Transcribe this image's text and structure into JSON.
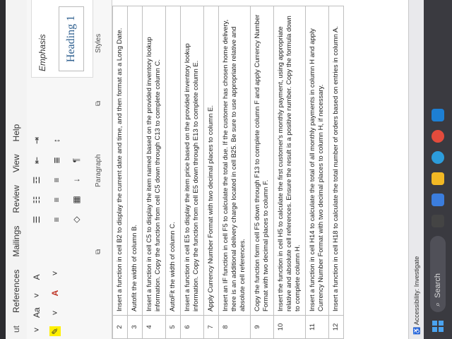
{
  "ribbon": {
    "tabs": [
      "ut",
      "References",
      "Mailings",
      "Review",
      "View",
      "Help"
    ],
    "font_size_label": "Aa",
    "paragraph_label": "Paragraph",
    "styles_label": "Styles",
    "style_emphasis": "Emphasis",
    "style_heading1": "Heading 1",
    "style_heading_partial": "Hea"
  },
  "steps": [
    {
      "num": "2",
      "text": "Insert a function in cell B2 to display the current date and time, and then format as a Long Date."
    },
    {
      "num": "3",
      "text": "Autofit the width of column B."
    },
    {
      "num": "4",
      "text": "Insert a function in cell C5 to display the item named based on the provided inventory lookup information. Copy the function from cell C5 down through C13 to complete column C."
    },
    {
      "num": "5",
      "text": "AutoFit the width of column C."
    },
    {
      "num": "6",
      "text": "Insert a function in cell E5 to display the item price based on the provided inventory lookup information. Copy the function from cell E5 down through E13 to complete column E."
    },
    {
      "num": "7",
      "text": "Apply Currency Number Format with two decimal places to column E."
    },
    {
      "num": "8",
      "text": "Insert an IF function in cell F5 to calculate the total due. If the customer has chosen home delivery, there is an additional delivery charge located in cell B25. Be sure to use appropriate relative and absolute cell references."
    },
    {
      "num": "9",
      "text": "Copy the function form cell F5 down through F13 to complete column F and apply Currency Number Format with two decimal places to column F."
    },
    {
      "num": "10",
      "text": "Insert the function in cell H5 to calculate the first customer's monthly payment, using appropriate relative and absolute cell references. Ensure the result is a positive number. Copy the formula down to complete column H."
    },
    {
      "num": "11",
      "text": "Insert a function in cell H14 to calculate the total of all monthly payments in column H and apply Currency Number Format with two decimal places to column H, if necessary."
    },
    {
      "num": "12",
      "text": "Insert a function in cell H18 to calculate the total number of orders based on entries in column A."
    }
  ],
  "status": {
    "accessibility": "Accessibility: Investigate"
  },
  "taskbar": {
    "search_placeholder": "Search"
  }
}
